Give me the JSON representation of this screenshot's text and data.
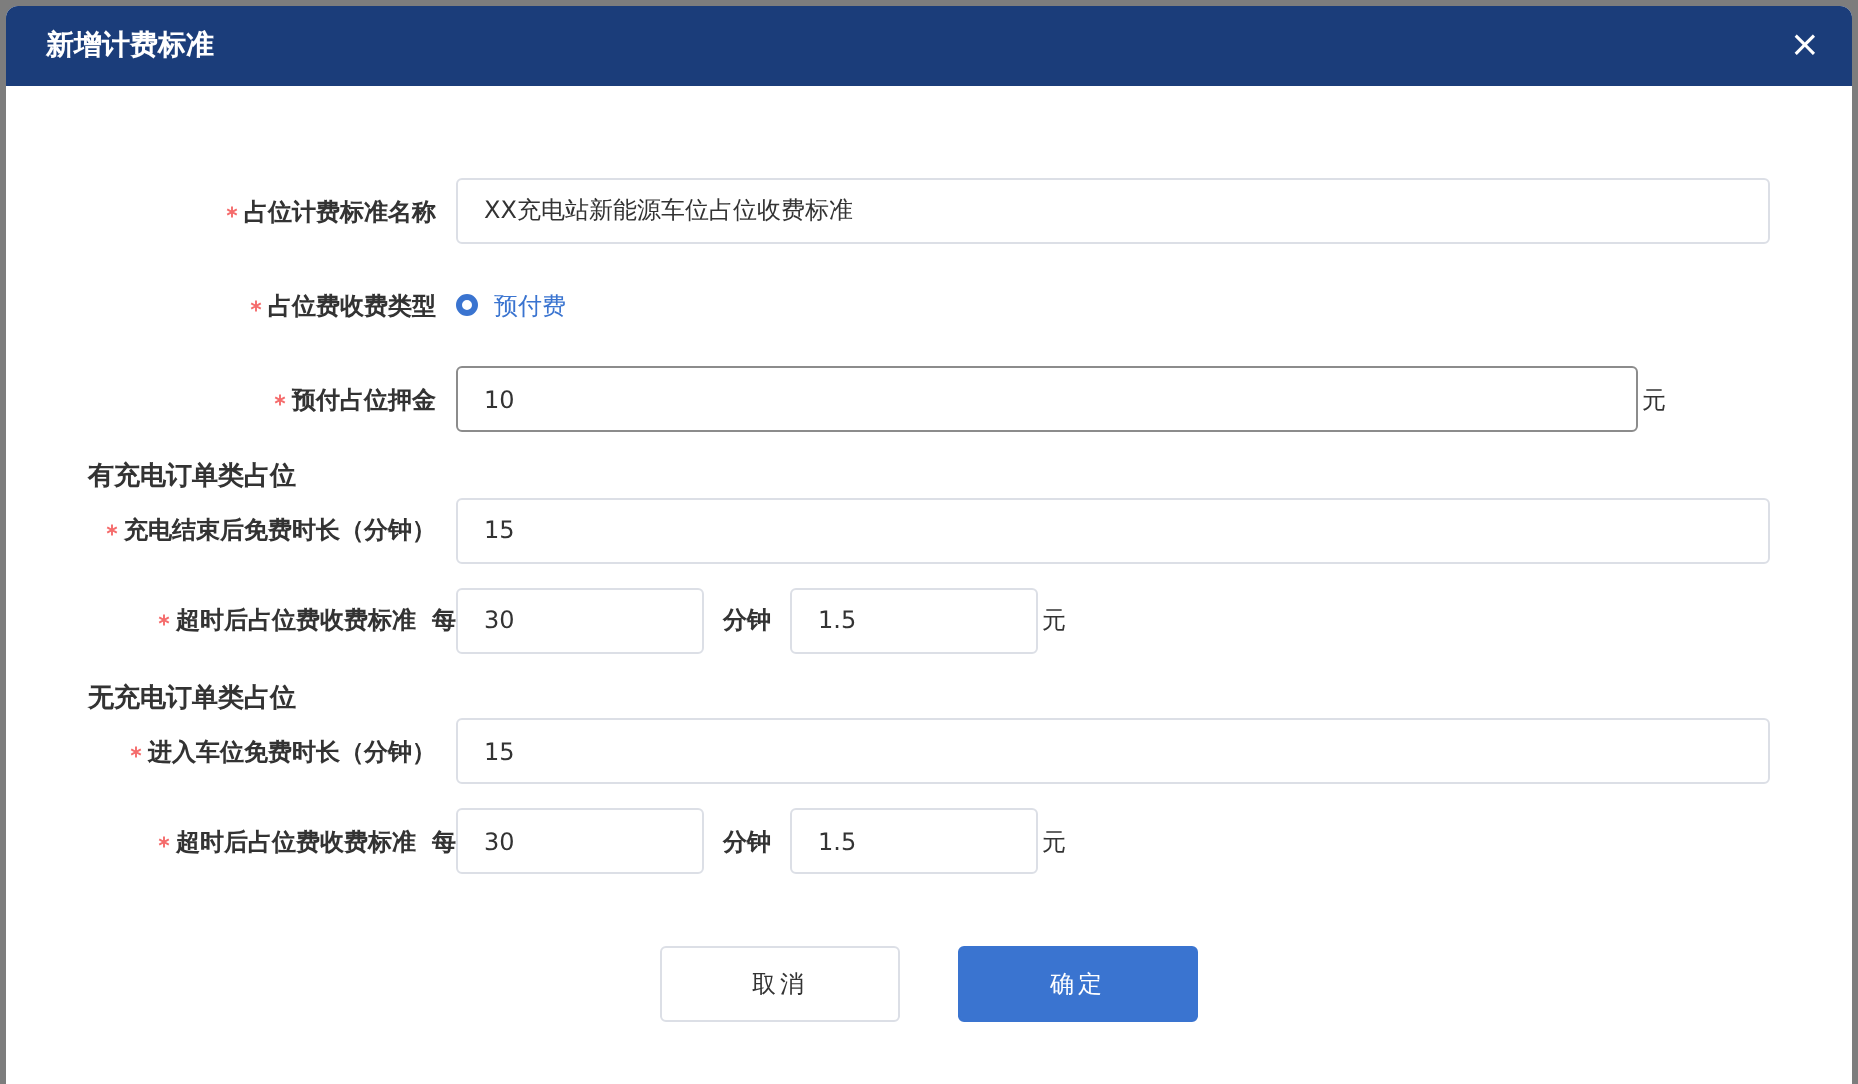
{
  "dialog": {
    "title": "新增计费标准",
    "close": "×"
  },
  "fields": [
    {
      "kind": "text",
      "label": "占位计费标准名称",
      "required": true,
      "value": "XX充电站新能源车位占位收费标准",
      "focused": false
    },
    {
      "kind": "radio",
      "label": "占位费收费类型",
      "required": true,
      "options": [
        {
          "label": "预付费",
          "selected": true
        }
      ]
    },
    {
      "kind": "text",
      "label": "预付占位押金",
      "required": true,
      "value": "10",
      "unit": "元",
      "focused": true
    }
  ],
  "sections": [
    {
      "heading": "有充电订单类占位",
      "fields": [
        {
          "kind": "text",
          "label": "充电结束后免费时长（分钟）",
          "required": true,
          "value": "15",
          "focused": false
        },
        {
          "kind": "rate",
          "label": "超时后占位费收费标准",
          "required": true,
          "prefix": "每",
          "minutes": "30",
          "minutes_unit": "分钟",
          "amount": "1.5",
          "unit": "元"
        }
      ]
    },
    {
      "heading": "无充电订单类占位",
      "fields": [
        {
          "kind": "text",
          "label": "进入车位免费时长（分钟）",
          "required": true,
          "value": "15",
          "focused": false
        },
        {
          "kind": "rate",
          "label": "超时后占位费收费标准",
          "required": true,
          "prefix": "每",
          "minutes": "30",
          "minutes_unit": "分钟",
          "amount": "1.5",
          "unit": "元"
        }
      ]
    }
  ],
  "buttons": [
    {
      "label": "取消",
      "kind": "secondary"
    },
    {
      "label": "确定",
      "kind": "primary"
    }
  ]
}
